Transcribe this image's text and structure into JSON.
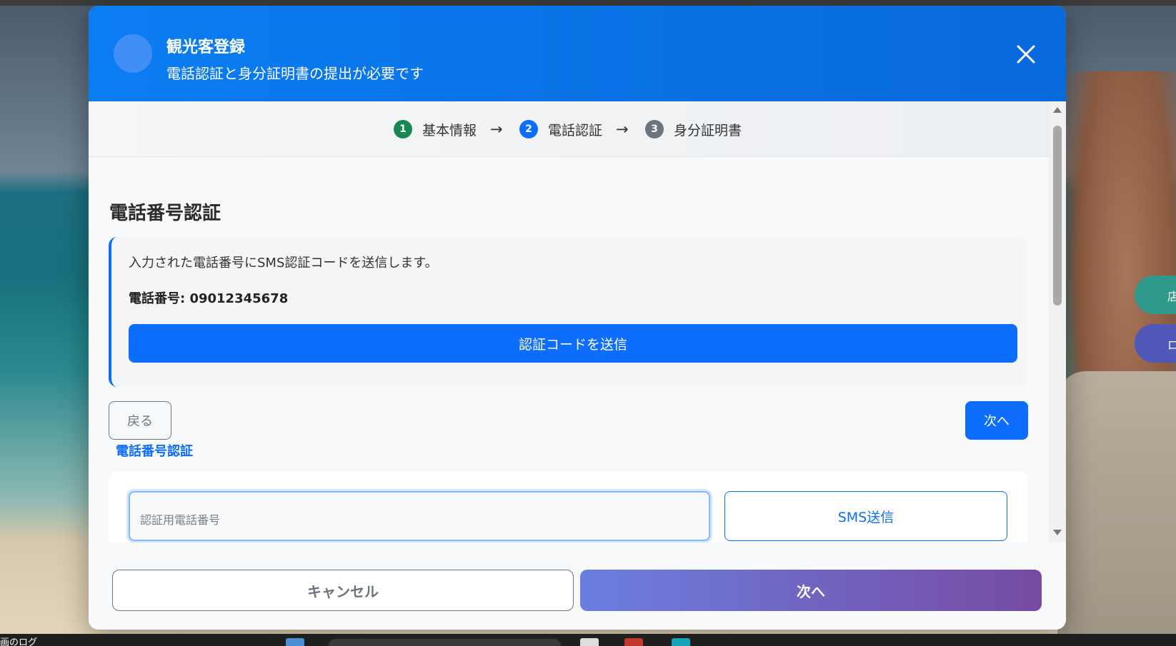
{
  "modal": {
    "title": "観光客登録",
    "subtitle": "電話認証と身分証明書の提出が必要です"
  },
  "stepper": {
    "steps": [
      {
        "number": "1",
        "label": "基本情報",
        "state": "completed",
        "color": "#198754"
      },
      {
        "number": "2",
        "label": "電話認証",
        "state": "active",
        "color": "#0d6efd"
      },
      {
        "number": "3",
        "label": "身分証明書",
        "state": "pending",
        "color": "#6c757d"
      }
    ],
    "arrow": "→"
  },
  "phone_section": {
    "title": "電話番号認証",
    "info_text": "入力された電話番号にSMS認証コードを送信します。",
    "phone_label": "電話番号: 09012345678",
    "send_code_button": "認証コードを送信",
    "back_button": "戻る",
    "next_button": "次へ"
  },
  "verification_form": {
    "subtitle": "電話番号認証",
    "phone_input_placeholder": "認証用電話番号",
    "phone_input_value": "",
    "sms_button": "SMS送信"
  },
  "footer": {
    "cancel_button": "キャンセル",
    "next_button": "次へ"
  },
  "taskbar": {
    "partial_text": "画のログ"
  },
  "colors": {
    "primary": "#0d6efd",
    "header_gradient_start": "#0b7df2",
    "header_gradient_end": "#0869db",
    "footer_next_gradient_start": "#6b7fe0",
    "footer_next_gradient_end": "#764ba2"
  },
  "icons": {
    "close": "close-icon",
    "avatar": "avatar"
  }
}
